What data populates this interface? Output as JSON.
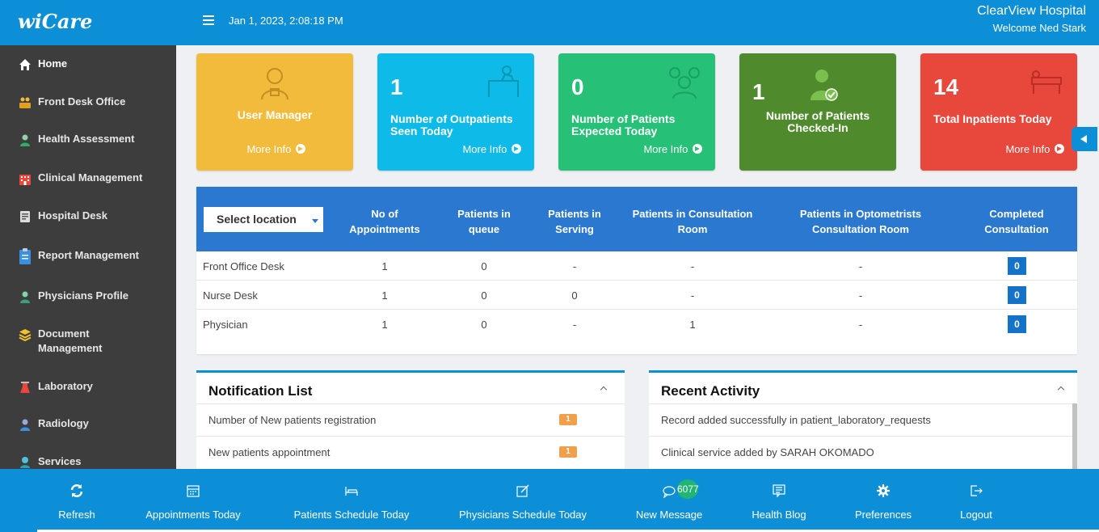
{
  "app": {
    "logo": "wiCare",
    "datetime": "Jan 1, 2023, 2:08:18 PM",
    "hospital": "ClearView Hospital",
    "welcome": "Welcome Ned Stark"
  },
  "sidebar": {
    "items": [
      {
        "label": "Home",
        "icon": "home-icon"
      },
      {
        "label": "Front Desk Office",
        "icon": "front-desk-icon"
      },
      {
        "label": "Health Assessment",
        "icon": "nurse-icon"
      },
      {
        "label": "Clinical Management",
        "icon": "hospital-building-icon"
      },
      {
        "label": "Hospital Desk",
        "icon": "hospital-desk-icon"
      },
      {
        "label": "Report Management",
        "icon": "clipboard-icon"
      },
      {
        "label": "Physicians Profile",
        "icon": "doctor-icon"
      },
      {
        "label": "Document",
        "label2": "Management",
        "icon": "layers-icon"
      },
      {
        "label": "Laboratory",
        "icon": "flask-icon"
      },
      {
        "label": "Radiology",
        "icon": "radiology-icon"
      },
      {
        "label": "Services",
        "icon": "services-icon"
      }
    ]
  },
  "cards": [
    {
      "title": "User Manager",
      "more": "More Info",
      "color": "#f2bb3c",
      "icon": "user-manager-icon"
    },
    {
      "number": "1",
      "title": "Number of Outpatients Seen Today",
      "more": "More Info",
      "color": "#0ebbe8",
      "icon": "outpatient-icon"
    },
    {
      "number": "0",
      "title": "Number of Patients Expected Today",
      "more": "More Info",
      "color": "#26c077",
      "icon": "group-icon"
    },
    {
      "number": "1",
      "title": "Number of Patients Checked-In",
      "color": "#4f8b2c",
      "icon": "checked-in-icon"
    },
    {
      "number": "14",
      "title": "Total Inpatients Today",
      "more": "More Info",
      "color": "#e8473b",
      "icon": "bed-icon"
    }
  ],
  "table": {
    "location_select": "Select location",
    "headers": [
      "No of\nAppointments",
      "Patients in\nqueue",
      "Patients in\nServing",
      "Patients in Consultation\nRoom",
      "Patients in Optometrists\nConsultation Room",
      "Completed\nConsultation"
    ],
    "rows": [
      {
        "name": "Front Office Desk",
        "appointments": "1",
        "queue": "0",
        "serving": "-",
        "consultation": "-",
        "optometrists": "-",
        "completed": "0"
      },
      {
        "name": "Nurse Desk",
        "appointments": "1",
        "queue": "0",
        "serving": "0",
        "consultation": "-",
        "optometrists": "-",
        "completed": "0"
      },
      {
        "name": "Physician",
        "appointments": "1",
        "queue": "0",
        "serving": "-",
        "consultation": "1",
        "optometrists": "-",
        "completed": "0"
      }
    ]
  },
  "notifications": {
    "title": "Notification List",
    "items": [
      {
        "text": "Number of New patients registration",
        "count": "1"
      },
      {
        "text": "New patients appointment",
        "count": "1"
      }
    ]
  },
  "activity": {
    "title": "Recent Activity",
    "items": [
      {
        "text": "Record added successfully in patient_laboratory_requests"
      },
      {
        "text": "Clinical service added by SARAH OKOMADO"
      }
    ]
  },
  "bottom_nav": {
    "items": [
      {
        "label": "Refresh",
        "icon": "refresh-icon"
      },
      {
        "label": "Appointments Today",
        "icon": "calendar-icon"
      },
      {
        "label": "Patients Schedule Today",
        "icon": "bed-icon"
      },
      {
        "label": "Physicians Schedule Today",
        "icon": "edit-icon"
      },
      {
        "label": "New Message",
        "icon": "message-icon",
        "badge": "6077"
      },
      {
        "label": "Health Blog",
        "icon": "blog-icon"
      },
      {
        "label": "Preferences",
        "icon": "gear-icon"
      },
      {
        "label": "Logout",
        "icon": "logout-icon"
      }
    ]
  },
  "colors": {
    "primary": "#0c8fd6",
    "sidebar": "#3d3d3d",
    "table_header": "#2b78d0"
  }
}
